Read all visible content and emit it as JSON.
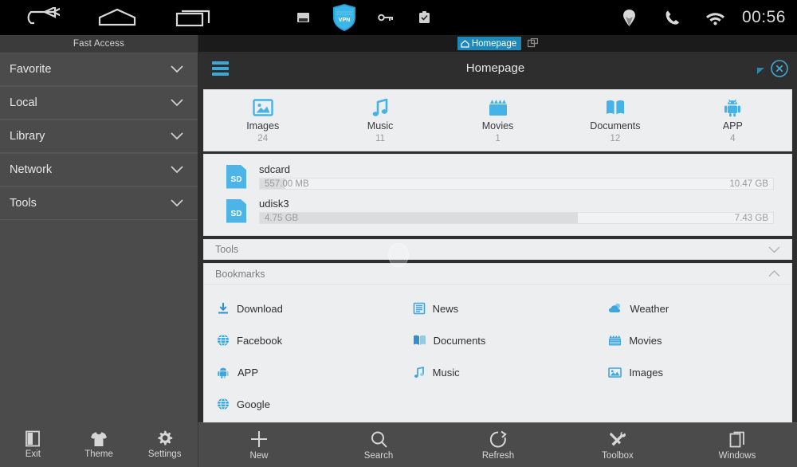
{
  "statusbar": {
    "nav_icons": [
      "back-icon",
      "home-icon",
      "recents-icon"
    ],
    "tray_icons": [
      "screenshot-icon",
      "vpn-shield-icon",
      "key-icon",
      "clipboard-icon"
    ],
    "right_icons": [
      "location-icon",
      "phone-icon",
      "wifi-icon"
    ],
    "clock": "00:56",
    "vpn_label": "VPN"
  },
  "sidebar": {
    "title": "Fast Access",
    "items": [
      {
        "label": "Favorite",
        "icon": "chevron-down-icon"
      },
      {
        "label": "Local",
        "icon": "chevron-down-icon"
      },
      {
        "label": "Library",
        "icon": "chevron-down-icon"
      },
      {
        "label": "Network",
        "icon": "chevron-down-icon"
      },
      {
        "label": "Tools",
        "icon": "chevron-down-icon"
      }
    ]
  },
  "tabstrip": {
    "active_tab": "Homepage",
    "tab_icon": "home-icon",
    "new_tab_icon": "new-tab-icon"
  },
  "toolbar": {
    "menu_icon": "hamburger-menu-icon",
    "title": "Homepage",
    "resize_icon": "resize-handle-icon",
    "close_icon": "close-circle-icon",
    "accent": "#3fa8d4"
  },
  "categories": [
    {
      "label": "Images",
      "count": "24",
      "icon": "image-icon"
    },
    {
      "label": "Music",
      "count": "11",
      "icon": "music-note-icon"
    },
    {
      "label": "Movies",
      "count": "1",
      "icon": "movie-clapper-icon"
    },
    {
      "label": "Documents",
      "count": "12",
      "icon": "book-icon"
    },
    {
      "label": "APP",
      "count": "4",
      "icon": "android-icon"
    }
  ],
  "storage": [
    {
      "name": "sdcard",
      "icon": "sd-card-icon",
      "badge": "SD",
      "used": "557.00 MB",
      "free": "10.47 GB",
      "fill_percent": 5
    },
    {
      "name": "udisk3",
      "icon": "sd-card-icon",
      "badge": "SD",
      "used": "4.75 GB",
      "free": "7.43 GB",
      "fill_percent": 62
    }
  ],
  "sections": {
    "tools": {
      "label": "Tools",
      "chevron": "chevron-down-icon",
      "expanded": false
    },
    "bookmarks": {
      "label": "Bookmarks",
      "chevron": "chevron-up-icon",
      "expanded": true
    }
  },
  "bookmarks": [
    {
      "label": "Download",
      "icon": "download-icon"
    },
    {
      "label": "News",
      "icon": "news-icon"
    },
    {
      "label": "Weather",
      "icon": "weather-cloud-icon"
    },
    {
      "label": "Facebook",
      "icon": "globe-icon"
    },
    {
      "label": "Documents",
      "icon": "documents-icon"
    },
    {
      "label": "Movies",
      "icon": "movie-clapper-icon"
    },
    {
      "label": "APP",
      "icon": "android-icon"
    },
    {
      "label": "Music",
      "icon": "music-note-icon"
    },
    {
      "label": "Images",
      "icon": "image-icon"
    },
    {
      "label": "Google",
      "icon": "globe-icon"
    }
  ],
  "bottombar": {
    "left": [
      {
        "label": "Exit",
        "icon": "exit-icon"
      },
      {
        "label": "Theme",
        "icon": "tshirt-icon"
      },
      {
        "label": "Settings",
        "icon": "gear-icon"
      }
    ],
    "right": [
      {
        "label": "New",
        "icon": "plus-icon"
      },
      {
        "label": "Search",
        "icon": "search-icon"
      },
      {
        "label": "Refresh",
        "icon": "refresh-icon"
      },
      {
        "label": "Toolbox",
        "icon": "toolbox-icon"
      },
      {
        "label": "Windows",
        "icon": "windows-stack-icon"
      }
    ]
  }
}
